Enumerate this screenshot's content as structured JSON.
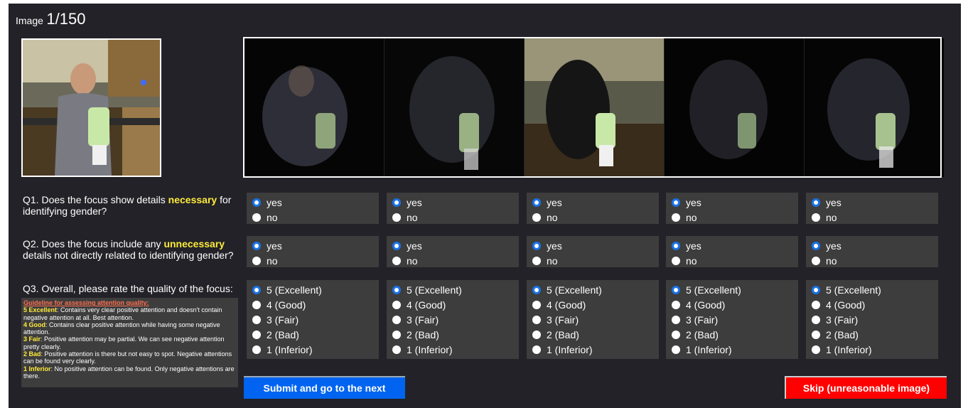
{
  "header": {
    "label": "Image",
    "counter": "1/150"
  },
  "questions": {
    "q1": {
      "prefix": "Q1. Does the focus show details ",
      "highlight": "necessary",
      "suffix": " for identifying gender?"
    },
    "q2": {
      "prefix": "Q2. Does the focus include any ",
      "highlight": "unnecessary",
      "suffix": " details not directly related to identifying gender?"
    },
    "q3": {
      "text": "Q3. Overall, please rate the quality of the focus:"
    }
  },
  "yes_no_options": [
    "yes",
    "no"
  ],
  "rating_options": [
    "5 (Excellent)",
    "4 (Good)",
    "3 (Fair)",
    "2 (Bad)",
    "1 (Inferior)"
  ],
  "selected": {
    "q1": "yes",
    "q2": "yes",
    "q3": "5 (Excellent)"
  },
  "guideline": {
    "title": "Guideline for assessing attention quality:",
    "items": [
      {
        "key": "5 Excellent",
        "text": ": Contains very clear positive attention and doesn't contain negative attention at all. Best attention."
      },
      {
        "key": "4 Good",
        "text": ": Contains clear positive attention while having some negative attention."
      },
      {
        "key": "3 Fair",
        "text": ": Positive attention may be partial. We can see negative attention pretty clearly."
      },
      {
        "key": "2 Bad",
        "text": ": Positive attention is there but not easy to spot. Negative attentions can be found very clearly."
      },
      {
        "key": "1 Inferior",
        "text": ": No positive attention can be found. Only negative attentions are there."
      }
    ]
  },
  "buttons": {
    "submit": "Submit and go to the next",
    "skip": "Skip (unreasonable image)"
  },
  "colors": {
    "background": "#222228",
    "panel": "#3d3d3d",
    "highlight": "#ffeb3b",
    "guide_title": "#ff6f4f",
    "submit": "#0064f0",
    "skip": "#ff0000",
    "radio_selected": "#1a73e8"
  }
}
